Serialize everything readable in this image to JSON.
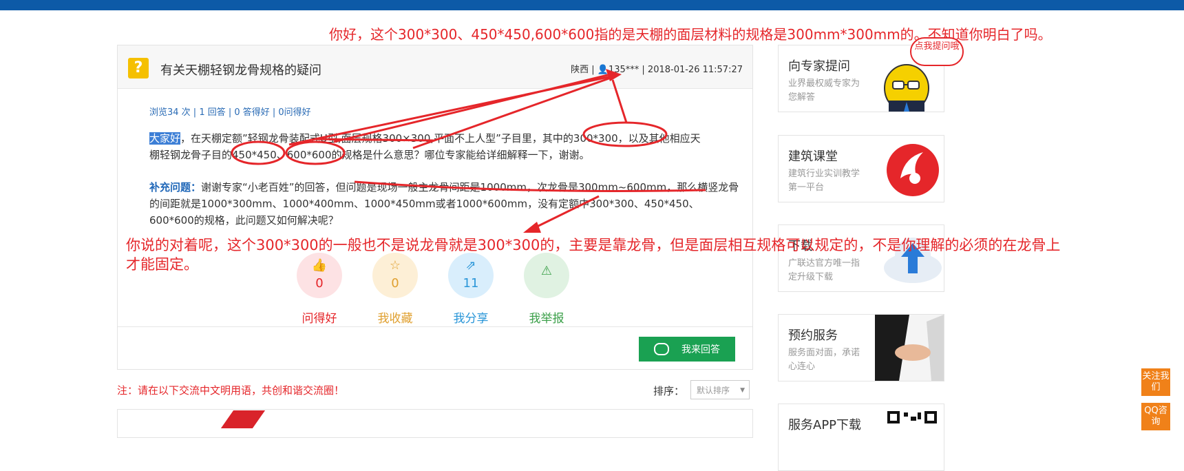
{
  "question": {
    "title": "有关天棚轻钢龙骨规格的疑问",
    "meta": "陕西 | 👤135*** | 2018-01-26 11:57:27",
    "stats": "浏览34 次 | 1 回答 | 0 答得好 | 0问得好",
    "body_highlight": "大家好",
    "body_line1": "，在天棚定额”轻钢龙骨装配式U型,面层规格300×300,平面不上人型”子目里，其中的300*300，以及其他相应天",
    "body_line2": "棚轻钢龙骨子目的450*450、600*600的规格是什么意思？哪位专家能给详细解释一下，谢谢。",
    "supplement_label": "补充问题：",
    "supplement_text": "谢谢专家“小老百姓”的回答，但问题是现场一般主龙骨间距是1000mm，次龙骨是300mm~600mm，那么横竖龙骨的间距就是1000*300mm、1000*400mm、1000*450mm或者1000*600mm，没有定额中300*300、450*450、600*600的规格，此问题又如何解决呢？"
  },
  "actions": [
    {
      "label": "问得好",
      "count": "0",
      "icon": "thumbs-up-icon",
      "color": "#e5262a",
      "bg": "#fde2e4"
    },
    {
      "label": "我收藏",
      "count": "0",
      "icon": "star-icon",
      "color": "#e0a030",
      "bg": "#fdefd6"
    },
    {
      "label": "我分享",
      "count": "11",
      "icon": "share-icon",
      "color": "#2a96d8",
      "bg": "#d9eefc"
    },
    {
      "label": "我举报",
      "count": "",
      "icon": "warning-icon",
      "color": "#3ca04a",
      "bg": "#e0f2e2"
    }
  ],
  "answer_button": "我来回答",
  "note": "注：请在以下交流中文明用语，共创和谐交流圈！",
  "sort": {
    "label": "排序：",
    "value": "默认排序"
  },
  "sidebar": [
    {
      "title": "向专家提问",
      "desc": "业界最权威专家为您解答"
    },
    {
      "title": "建筑课堂",
      "desc": "建筑行业实训教学第一平台"
    },
    {
      "title": "下载",
      "desc": "广联达官方唯一指定升级下载"
    },
    {
      "title": "预约服务",
      "desc": "服务面对面，承诺心连心"
    },
    {
      "title": "服务APP下载",
      "desc": ""
    }
  ],
  "cloud_text": "点我提问哦",
  "float_buttons": [
    "关注我们",
    "QQ咨询"
  ],
  "annotations": {
    "top": "你好，这个300*300、450*450,600*600指的是天棚的面层材料的规格是300mm*300mm的。不知道你明白了吗。",
    "bottom_line1": "你说的对着呢，这个300*300的一般也不是说龙骨就是300*300的，主要是靠龙骨，但是面层相互规格可以规定的，不是你理解的必须的在龙骨上",
    "bottom_line2": "才能固定。"
  },
  "colors": {
    "topbar": "#0d5aa7",
    "annotation": "#e5262a",
    "answer": "#1aa152",
    "link": "#2a6bb5"
  }
}
